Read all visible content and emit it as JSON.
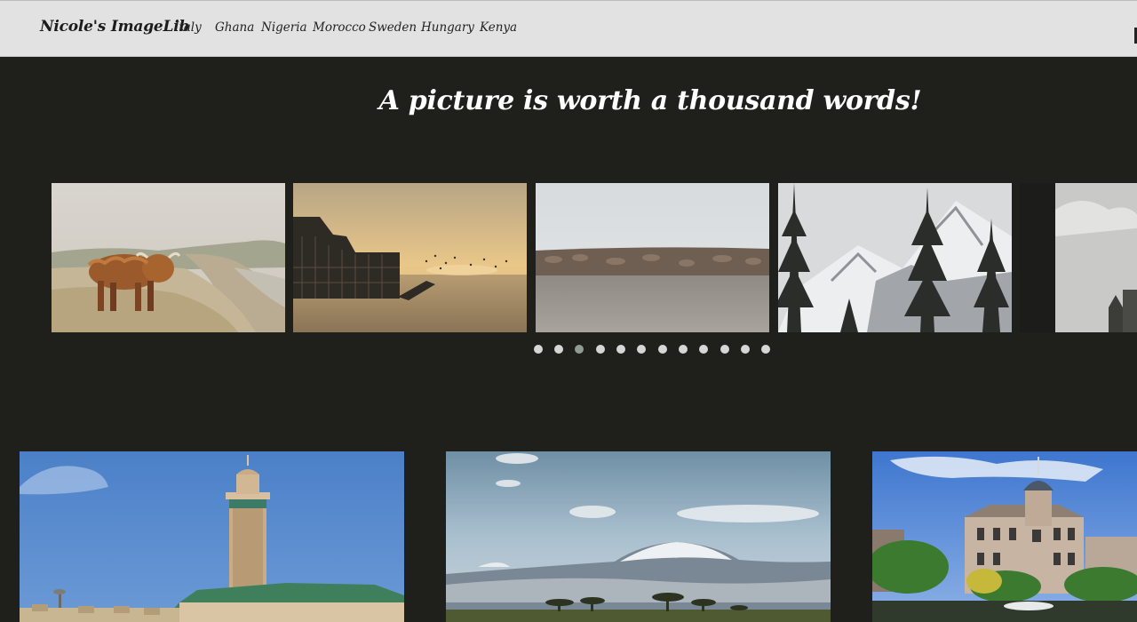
{
  "header": {
    "brand": "Nicole's ImageLib",
    "nav": [
      "Italy",
      "Ghana",
      "Nigeria",
      "Morocco",
      "Sweden",
      "Hungary",
      "Kenya"
    ]
  },
  "hero": {
    "tagline": "A picture is worth a thousand words!"
  },
  "carousel": {
    "slides": [
      {
        "subject": "highland cow on coastal cliffs"
      },
      {
        "subject": "ruined pier at sunset with birds"
      },
      {
        "subject": "stone breakwater over calm water"
      },
      {
        "subject": "snowy mountain with fir trees"
      },
      {
        "subject": "cloudy sky with building silhouette"
      }
    ],
    "dot_count": 12,
    "active_dot": 2
  },
  "gallery": {
    "cards": [
      {
        "subject": "mosque minaret under blue sky"
      },
      {
        "subject": "snow-capped mountain over savanna"
      },
      {
        "subject": "historic mansion by canal"
      }
    ]
  },
  "colors": {
    "background": "#1f1f1b",
    "header": "#e2e2e2",
    "dot": "#d6d6d6",
    "dot_active": "#8f9c94"
  }
}
